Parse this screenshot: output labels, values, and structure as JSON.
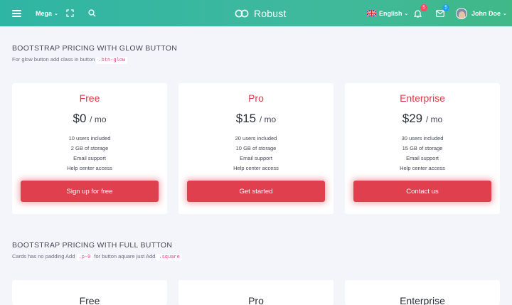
{
  "navbar": {
    "mega_label": "Mega",
    "brand": "Robust",
    "language": "English",
    "notifications_count": "5",
    "messages_count": "5",
    "user_name": "John Doe",
    "gradient_colors": [
      "#2fb5a4",
      "#40b888"
    ]
  },
  "glow_section": {
    "title": "BOOTSTRAP PRICING WITH GLOW BUTTON",
    "subtitle": "For glow button add class in button",
    "class_code": ".btn-glow"
  },
  "plans": [
    {
      "name": "Free",
      "price": "$0",
      "period": "/ mo",
      "features": [
        "10 users included",
        "2 GB of storage",
        "Email support",
        "Help center access"
      ],
      "button": "Sign up for free"
    },
    {
      "name": "Pro",
      "price": "$15",
      "period": "/ mo",
      "features": [
        "20 users included",
        "10 GB of storage",
        "Email support",
        "Help center access"
      ],
      "button": "Get started"
    },
    {
      "name": "Enterprise",
      "price": "$29",
      "period": "/ mo",
      "features": [
        "30 users included",
        "15 GB of storage",
        "Email support",
        "Help center access"
      ],
      "button": "Contact us"
    }
  ],
  "full_section": {
    "title": "BOOTSTRAP PRICING WITH FULL BUTTON",
    "subtitle_part1": "Cards has no padding Add",
    "code1": ".p-0",
    "subtitle_part2": "for button aquare just Add",
    "code2": ".square"
  },
  "plans_full": [
    {
      "name": "Free"
    },
    {
      "name": "Pro"
    },
    {
      "name": "Enterprise"
    }
  ],
  "colors": {
    "accent": "#e0404e",
    "title_red": "#e0394a",
    "background": "#f4f5fa"
  }
}
